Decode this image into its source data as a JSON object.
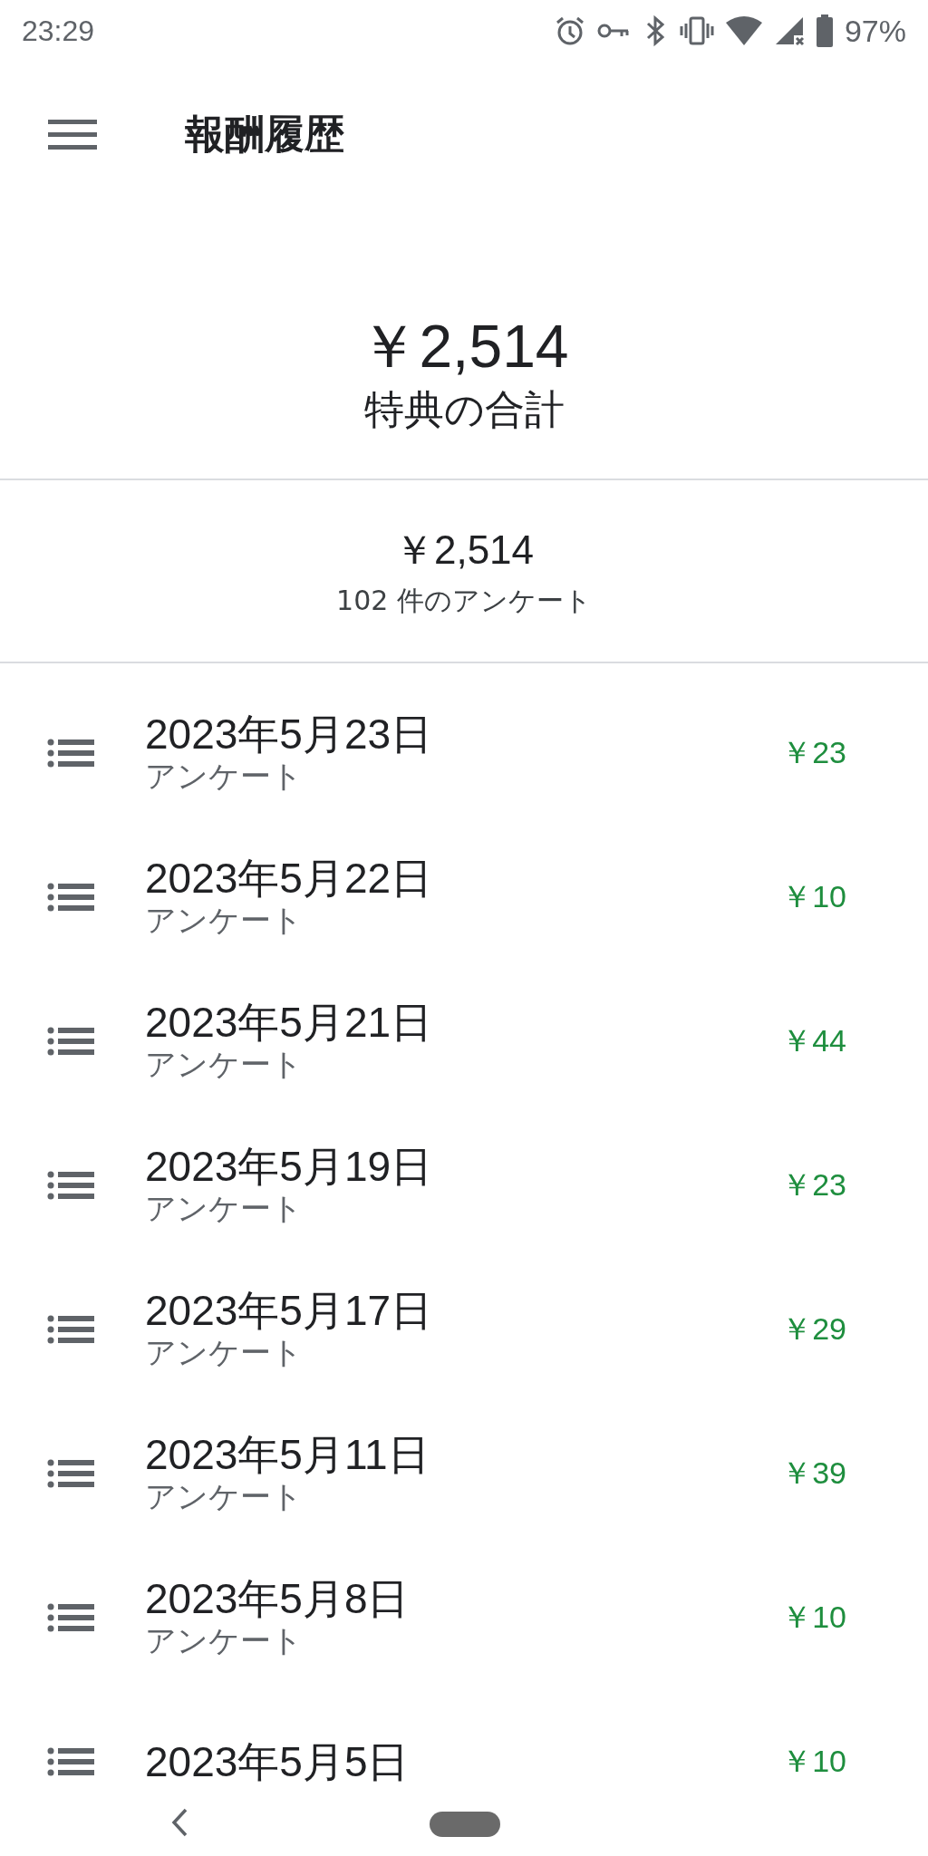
{
  "status_bar": {
    "time": "23:29",
    "battery": "97%"
  },
  "app_bar": {
    "title": "報酬履歴"
  },
  "summary": {
    "amount": "￥2,514",
    "label": "特典の合計"
  },
  "subtotal": {
    "amount": "￥2,514",
    "count": "102 件のアンケート"
  },
  "rewards": [
    {
      "date": "2023年5月23日",
      "type": "アンケート",
      "amount": "￥23"
    },
    {
      "date": "2023年5月22日",
      "type": "アンケート",
      "amount": "￥10"
    },
    {
      "date": "2023年5月21日",
      "type": "アンケート",
      "amount": "￥44"
    },
    {
      "date": "2023年5月19日",
      "type": "アンケート",
      "amount": "￥23"
    },
    {
      "date": "2023年5月17日",
      "type": "アンケート",
      "amount": "￥29"
    },
    {
      "date": "2023年5月11日",
      "type": "アンケート",
      "amount": "￥39"
    },
    {
      "date": "2023年5月8日",
      "type": "アンケート",
      "amount": "￥10"
    },
    {
      "date": "2023年5月5日",
      "amount": "￥10"
    }
  ]
}
